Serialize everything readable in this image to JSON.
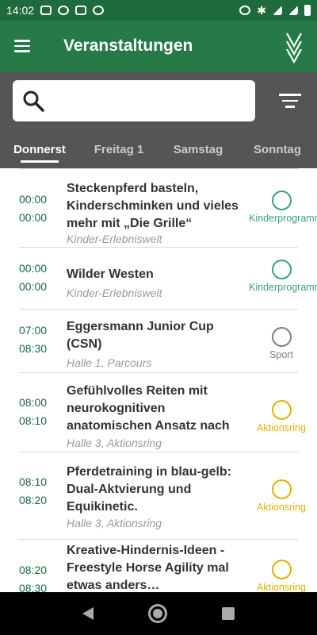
{
  "statusbar": {
    "time": "14:02"
  },
  "appbar": {
    "title": "Veranstaltungen"
  },
  "search": {
    "placeholder": ""
  },
  "tabs": [
    {
      "label": "Donnerst",
      "active": true
    },
    {
      "label": "Freitag 1",
      "active": false
    },
    {
      "label": "Samstag",
      "active": false
    },
    {
      "label": "Sonntag",
      "active": false
    }
  ],
  "events": [
    {
      "start": "00:00",
      "end": "00:00",
      "title": "Steckenpferd basteln, Kinderschminken und vieles mehr mit „Die Grille“",
      "location": "Kinder-Erlebniswelt",
      "category": "Kinderprogramm",
      "category_color": "#3aa17e"
    },
    {
      "start": "00:00",
      "end": "00:00",
      "title": "Wilder Westen",
      "location": "Kinder-Erlebniswelt",
      "category": "Kinderprogramm",
      "category_color": "#3aa17e"
    },
    {
      "start": "07:00",
      "end": "08:30",
      "title": "Eggersmann Junior Cup (CSN)",
      "location": "Halle 1, Parcours",
      "category": "Sport",
      "category_color": "#8c7b70"
    },
    {
      "start": "08:00",
      "end": "08:10",
      "title": "Gefühlvolles Reiten mit neurokognitiven anatomischen Ansatz nach",
      "location": "Halle 3, Aktionsring",
      "category": "Aktionsring",
      "category_color": "#e3b000"
    },
    {
      "start": "08:10",
      "end": "08:20",
      "title": "Pferdetraining in blau-gelb: Dual-Aktvierung und Equikinetic.",
      "location": "Halle 3, Aktionsring",
      "category": "Aktionsring",
      "category_color": "#e3b000"
    },
    {
      "start": "08:20",
      "end": "08:30",
      "title": "Kreative-Hindernis-Ideen - Freestyle Horse Agility mal etwas anders…",
      "location": "",
      "category": "Aktionsring",
      "category_color": "#e3b000"
    }
  ]
}
